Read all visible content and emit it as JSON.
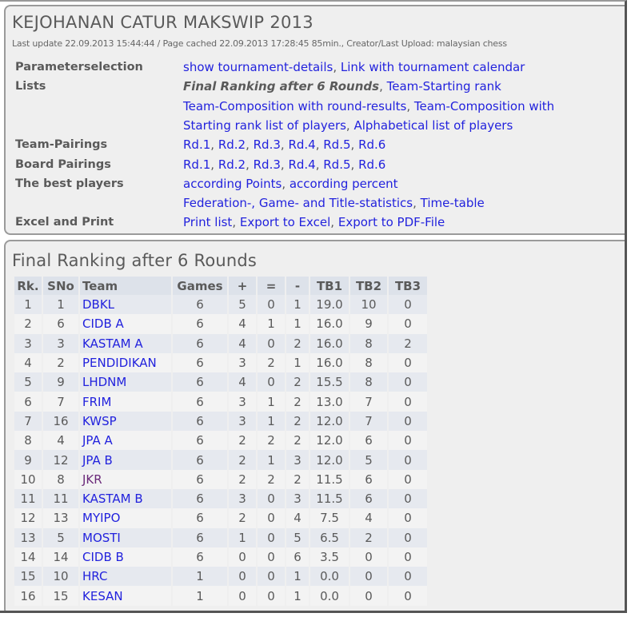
{
  "header": {
    "title": "KEJOHANAN CATUR MAKSWIP 2013",
    "meta": "Last update 22.09.2013 15:44:44 / Page cached 22.09.2013 17:28:45 85min., Creator/Last Upload: malaysian chess"
  },
  "menu": [
    {
      "label": "Parameterselection",
      "lines": [
        [
          {
            "text": "show tournament-details",
            "current": false
          },
          {
            "text": "Link with tournament calendar",
            "current": false
          }
        ]
      ]
    },
    {
      "label": "Lists",
      "lines": [
        [
          {
            "text": "Final Ranking after 6 Rounds",
            "current": true
          },
          {
            "text": "Team-Starting rank",
            "current": false
          }
        ],
        [
          {
            "text": "Team-Composition with round-results",
            "current": false
          },
          {
            "text": "Team-Composition with",
            "current": false
          }
        ],
        [
          {
            "text": "Starting rank list of players",
            "current": false
          },
          {
            "text": "Alphabetical list of players",
            "current": false
          }
        ]
      ]
    },
    {
      "label": "Team-Pairings",
      "lines": [
        [
          {
            "text": "Rd.1"
          },
          {
            "text": "Rd.2"
          },
          {
            "text": "Rd.3"
          },
          {
            "text": "Rd.4"
          },
          {
            "text": "Rd.5"
          },
          {
            "text": "Rd.6"
          }
        ]
      ]
    },
    {
      "label": "Board Pairings",
      "lines": [
        [
          {
            "text": "Rd.1"
          },
          {
            "text": "Rd.2"
          },
          {
            "text": "Rd.3"
          },
          {
            "text": "Rd.4"
          },
          {
            "text": "Rd.5"
          },
          {
            "text": "Rd.6"
          }
        ]
      ]
    },
    {
      "label": "The best players",
      "lines": [
        [
          {
            "text": "according Points"
          },
          {
            "text": "according percent"
          }
        ],
        [
          {
            "text": "Federation-, Game- and Title-statistics"
          },
          {
            "text": "Time-table"
          }
        ]
      ]
    },
    {
      "label": "Excel and Print",
      "lines": [
        [
          {
            "text": "Print list"
          },
          {
            "text": "Export to Excel"
          },
          {
            "text": "Export to PDF-File"
          }
        ]
      ]
    }
  ],
  "ranking": {
    "title": "Final Ranking after 6 Rounds",
    "columns": [
      "Rk.",
      "SNo",
      "Team",
      "Games",
      "+",
      "=",
      "-",
      "TB1",
      "TB2",
      "TB3"
    ],
    "rows": [
      {
        "rk": "1",
        "sno": "1",
        "team": "DBKL",
        "games": "6",
        "w": "5",
        "d": "0",
        "l": "1",
        "tb1": "19.0",
        "tb2": "10",
        "tb3": "0",
        "visited": false
      },
      {
        "rk": "2",
        "sno": "6",
        "team": "CIDB A",
        "games": "6",
        "w": "4",
        "d": "1",
        "l": "1",
        "tb1": "16.0",
        "tb2": "9",
        "tb3": "0",
        "visited": false
      },
      {
        "rk": "3",
        "sno": "3",
        "team": "KASTAM A",
        "games": "6",
        "w": "4",
        "d": "0",
        "l": "2",
        "tb1": "16.0",
        "tb2": "8",
        "tb3": "2",
        "visited": false
      },
      {
        "rk": "4",
        "sno": "2",
        "team": "PENDIDIKAN",
        "games": "6",
        "w": "3",
        "d": "2",
        "l": "1",
        "tb1": "16.0",
        "tb2": "8",
        "tb3": "0",
        "visited": false
      },
      {
        "rk": "5",
        "sno": "9",
        "team": "LHDNM",
        "games": "6",
        "w": "4",
        "d": "0",
        "l": "2",
        "tb1": "15.5",
        "tb2": "8",
        "tb3": "0",
        "visited": false
      },
      {
        "rk": "6",
        "sno": "7",
        "team": "FRIM",
        "games": "6",
        "w": "3",
        "d": "1",
        "l": "2",
        "tb1": "13.0",
        "tb2": "7",
        "tb3": "0",
        "visited": false
      },
      {
        "rk": "7",
        "sno": "16",
        "team": "KWSP",
        "games": "6",
        "w": "3",
        "d": "1",
        "l": "2",
        "tb1": "12.0",
        "tb2": "7",
        "tb3": "0",
        "visited": false
      },
      {
        "rk": "8",
        "sno": "4",
        "team": "JPA A",
        "games": "6",
        "w": "2",
        "d": "2",
        "l": "2",
        "tb1": "12.0",
        "tb2": "6",
        "tb3": "0",
        "visited": false
      },
      {
        "rk": "9",
        "sno": "12",
        "team": "JPA B",
        "games": "6",
        "w": "2",
        "d": "1",
        "l": "3",
        "tb1": "12.0",
        "tb2": "5",
        "tb3": "0",
        "visited": false
      },
      {
        "rk": "10",
        "sno": "8",
        "team": "JKR",
        "games": "6",
        "w": "2",
        "d": "2",
        "l": "2",
        "tb1": "11.5",
        "tb2": "6",
        "tb3": "0",
        "visited": true
      },
      {
        "rk": "11",
        "sno": "11",
        "team": "KASTAM B",
        "games": "6",
        "w": "3",
        "d": "0",
        "l": "3",
        "tb1": "11.5",
        "tb2": "6",
        "tb3": "0",
        "visited": false
      },
      {
        "rk": "12",
        "sno": "13",
        "team": "MYIPO",
        "games": "6",
        "w": "2",
        "d": "0",
        "l": "4",
        "tb1": "7.5",
        "tb2": "4",
        "tb3": "0",
        "visited": false
      },
      {
        "rk": "13",
        "sno": "5",
        "team": "MOSTI",
        "games": "6",
        "w": "1",
        "d": "0",
        "l": "5",
        "tb1": "6.5",
        "tb2": "2",
        "tb3": "0",
        "visited": false
      },
      {
        "rk": "14",
        "sno": "14",
        "team": "CIDB B",
        "games": "6",
        "w": "0",
        "d": "0",
        "l": "6",
        "tb1": "3.5",
        "tb2": "0",
        "tb3": "0",
        "visited": false
      },
      {
        "rk": "15",
        "sno": "10",
        "team": "HRC",
        "games": "1",
        "w": "0",
        "d": "0",
        "l": "1",
        "tb1": "0.0",
        "tb2": "0",
        "tb3": "0",
        "visited": false
      },
      {
        "rk": "16",
        "sno": "15",
        "team": "KESAN",
        "games": "1",
        "w": "0",
        "d": "0",
        "l": "1",
        "tb1": "0.0",
        "tb2": "0",
        "tb3": "0",
        "visited": false
      }
    ]
  },
  "colors": {
    "link": "#2222dd",
    "visited_link": "#6b2a7a",
    "text": "#5a5a5a",
    "panel_bg": "#efefef",
    "header_bg": "#dde2ea"
  }
}
